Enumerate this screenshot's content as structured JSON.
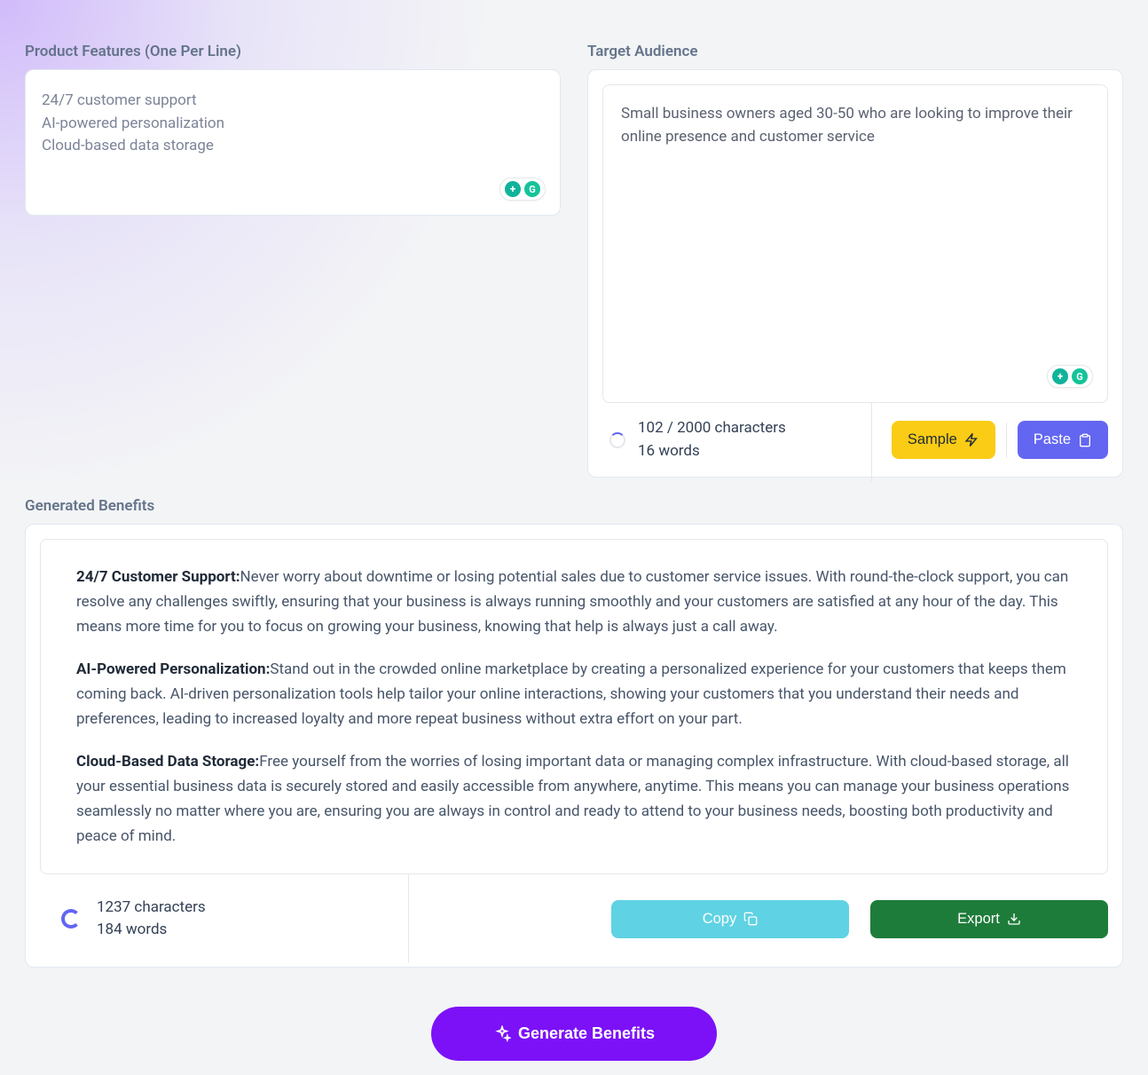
{
  "features": {
    "label": "Product Features (One Per Line)",
    "value": "24/7 customer support\nAI-powered personalization\nCloud-based data storage"
  },
  "audience": {
    "label": "Target Audience",
    "value": "Small business owners aged 30-50 who are looking to improve their online presence and customer service",
    "char_count": "102 / 2000 characters",
    "word_count": "16 words"
  },
  "buttons": {
    "sample": "Sample",
    "paste": "Paste",
    "copy": "Copy",
    "export": "Export",
    "generate": "Generate Benefits"
  },
  "generated": {
    "label": "Generated Benefits",
    "items": [
      {
        "title": "24/7 Customer Support:",
        "body": "Never worry about downtime or losing potential sales due to customer service issues. With round-the-clock support, you can resolve any challenges swiftly, ensuring that your business is always running smoothly and your customers are satisfied at any hour of the day. This means more time for you to focus on growing your business, knowing that help is always just a call away."
      },
      {
        "title": "AI-Powered Personalization:",
        "body": "Stand out in the crowded online marketplace by creating a personalized experience for your customers that keeps them coming back. AI-driven personalization tools help tailor your online interactions, showing your customers that you understand their needs and preferences, leading to increased loyalty and more repeat business without extra effort on your part."
      },
      {
        "title": "Cloud-Based Data Storage:",
        "body": "Free yourself from the worries of losing important data or managing complex infrastructure. With cloud-based storage, all your essential business data is securely stored and easily accessible from anywhere, anytime. This means you can manage your business operations seamlessly no matter where you are, ensuring you are always in control and ready to attend to your business needs, boosting both productivity and peace of mind."
      }
    ],
    "char_count": "1237 characters",
    "word_count": "184 words"
  }
}
